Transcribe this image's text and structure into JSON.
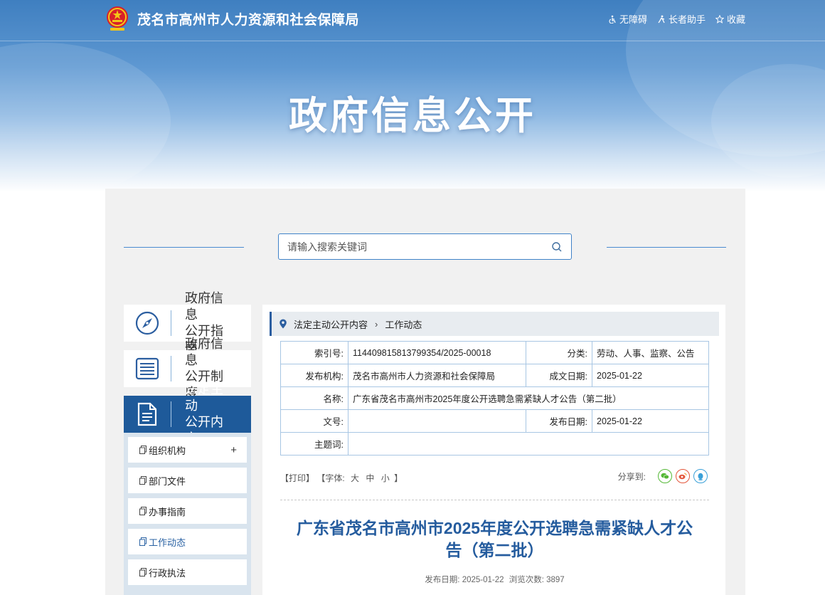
{
  "header": {
    "site_name": "茂名市高州市人力资源和社会保障局",
    "links": [
      "无障碍",
      "长者助手",
      "收藏"
    ],
    "banner_title": "政府信息公开"
  },
  "search": {
    "placeholder": "请输入搜索关键词"
  },
  "sidebar": {
    "cards": [
      {
        "line1": "政府信息",
        "line2": "公开指南",
        "icon": "compass-icon"
      },
      {
        "line1": "政府信息",
        "line2": "公开制度",
        "icon": "list-icon"
      },
      {
        "line1": "法定主动",
        "line2": "公开内容",
        "icon": "document-icon"
      }
    ],
    "items": [
      "组织机构",
      "部门文件",
      "办事指南",
      "工作动态",
      "行政执法"
    ],
    "expand_symbol": "+"
  },
  "breadcrumb": {
    "root": "法定主动公开内容",
    "current": "工作动态"
  },
  "meta": {
    "index_label": "索引号:",
    "index_value": "114409815813799354/2025-00018",
    "category_label": "分类:",
    "category_value": "劳动、人事、监察、公告",
    "publisher_label": "发布机构:",
    "publisher_value": "茂名市高州市人力资源和社会保障局",
    "written_label": "成文日期:",
    "written_value": "2025-01-22",
    "name_label": "名称:",
    "name_value": "广东省茂名市高州市2025年度公开选聘急需紧缺人才公告（第二批）",
    "docno_label": "文号:",
    "docno_value": "",
    "pubdate_label": "发布日期:",
    "pubdate_value": "2025-01-22",
    "subject_label": "主题词:",
    "subject_value": ""
  },
  "tools": {
    "print": "【打印】",
    "font_prefix": "【字体:",
    "large": "大",
    "medium": "中",
    "small": "小",
    "font_suffix": "】",
    "share_label": "分享到:"
  },
  "article": {
    "title_line1": "广东省茂名市高州市2025年度公开选聘急需紧缺人才公",
    "title_line2": "告（第二批）",
    "date_label": "发布日期:",
    "date": "2025-01-22",
    "views_label": "浏览次数:",
    "views": "3897"
  },
  "colors": {
    "accent": "#1e5a9a",
    "title": "#255c9e",
    "border": "#a8c6e3"
  }
}
